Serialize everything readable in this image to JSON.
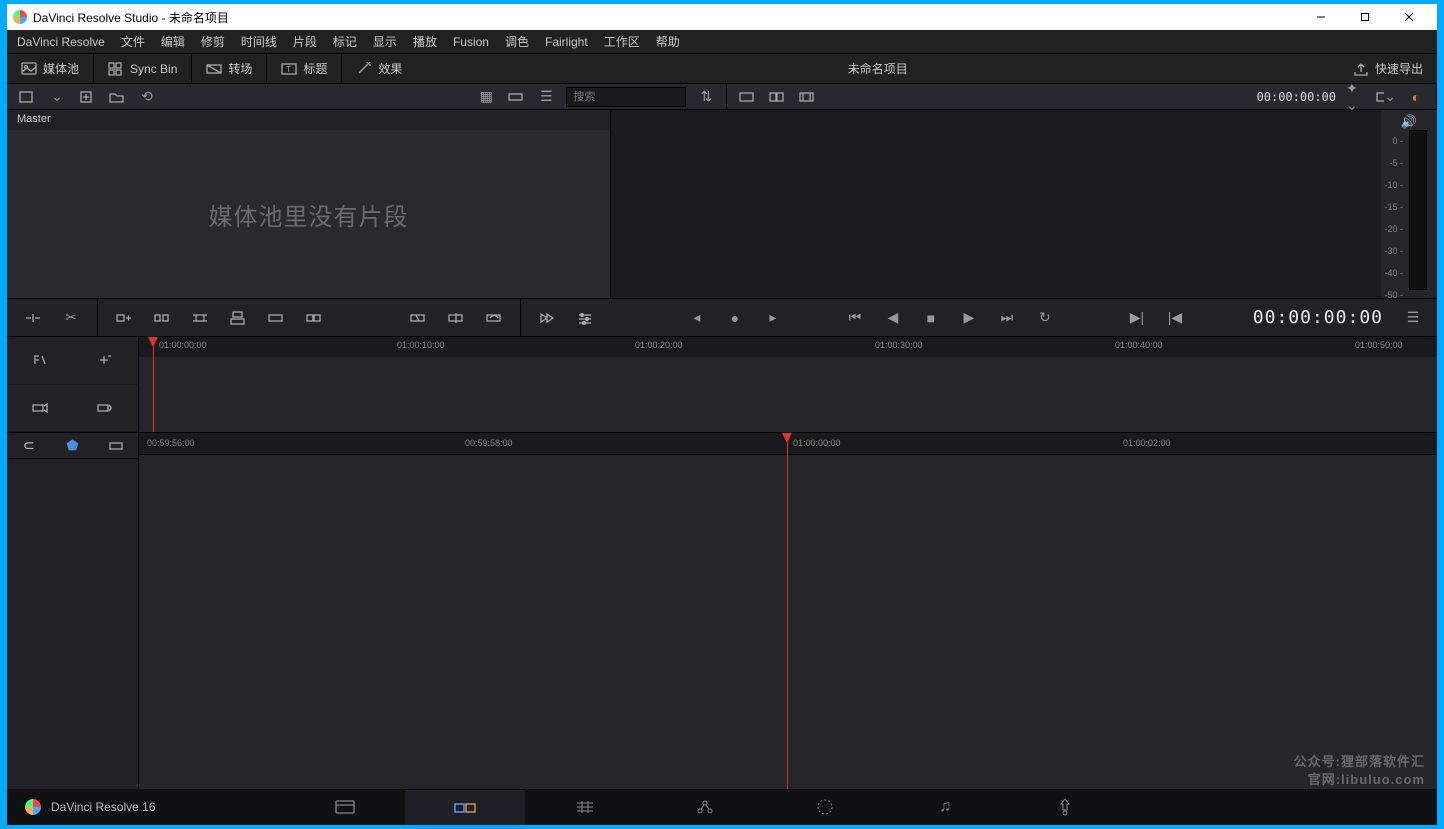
{
  "window": {
    "title": "DaVinci Resolve Studio - 未命名项目"
  },
  "menu": {
    "items": [
      "DaVinci Resolve",
      "文件",
      "编辑",
      "修剪",
      "时间线",
      "片段",
      "标记",
      "显示",
      "播放",
      "Fusion",
      "调色",
      "Fairlight",
      "工作区",
      "帮助"
    ]
  },
  "uitoolbar": {
    "mediapool": "媒体池",
    "syncbin": "Sync Bin",
    "transitions": "转场",
    "titles": "标题",
    "effects": "效果",
    "project_name": "未命名项目",
    "quick_export": "快速导出"
  },
  "toolstrip": {
    "search_placeholder": "搜索",
    "viewer_timecode": "00:00:00:00"
  },
  "mediapool": {
    "master": "Master",
    "empty_msg": "媒体池里没有片段"
  },
  "audiometer": {
    "ticks": [
      "0 -",
      "-5 -",
      "-10 -",
      "-15 -",
      "-20 -",
      "-30 -",
      "-40 -",
      "-50 -"
    ]
  },
  "transport": {
    "timecode": "00:00:00:00"
  },
  "timeline_upper": {
    "ticks": [
      "01:00:00:00",
      "01:00:10:00",
      "01:00:20:00",
      "01:00:30:00",
      "01:00:40:00",
      "01:00:50:00"
    ]
  },
  "timeline_lower": {
    "ticks": [
      "00:59:56:00",
      "00:59:58:00",
      "01:00:00:00",
      "01:00:02:00"
    ]
  },
  "pagenav": {
    "product": "DaVinci Resolve 16"
  },
  "watermark": {
    "line1": "公众号:狸部落软件汇",
    "line2": "官网:libuluo.com"
  }
}
